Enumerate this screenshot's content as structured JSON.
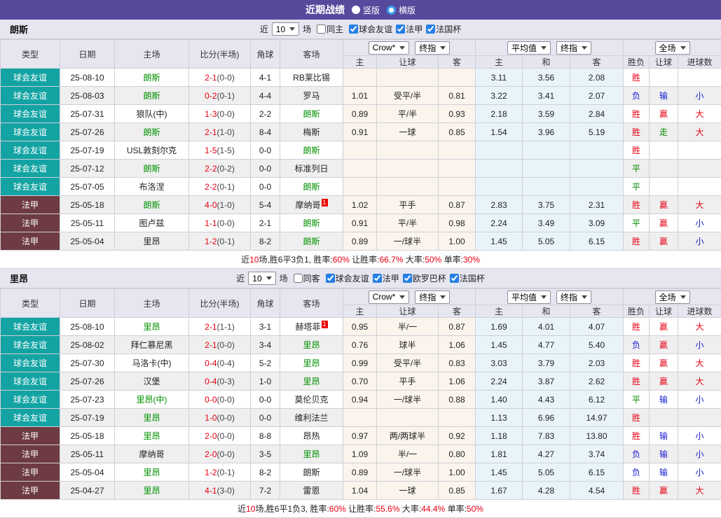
{
  "header": {
    "title": "近期战绩",
    "view_options": [
      {
        "label": "竖版",
        "selected": false
      },
      {
        "label": "横版",
        "selected": true
      }
    ]
  },
  "colors": {
    "header_purple": "#564a9d",
    "friendly_teal": "#13a3a3",
    "ligue1_maroon": "#6d3b41",
    "win_red": "#e60013",
    "loss_blue": "#1818d0",
    "draw_green": "#008800",
    "team_green": "#009100",
    "odds_col_bg": "#faf4ec",
    "avg_col_bg": "#e9f4fa"
  },
  "filter_words": {
    "near": "近",
    "games": "场"
  },
  "selects": {
    "count": "10",
    "odds_provider": "Crow*",
    "odds_stage": "终指",
    "avg_provider": "平均值",
    "avg_stage": "终指",
    "scope": "全场"
  },
  "columns": {
    "type": "类型",
    "date": "日期",
    "home": "主场",
    "score": "比分(半场)",
    "corner": "角球",
    "away": "客场",
    "odds_home": "主",
    "odds_handicap": "让球",
    "odds_away": "客",
    "avg_home": "主",
    "avg_draw": "和",
    "avg_away": "客",
    "result_wl": "胜负",
    "result_handicap": "让球",
    "result_goals": "进球数"
  },
  "sections": [
    {
      "team": "朗斯",
      "filter": {
        "same_label": "同主",
        "same_checked": false,
        "leagues": [
          {
            "label": "球会友谊",
            "checked": true
          },
          {
            "label": "法甲",
            "checked": true
          },
          {
            "label": "法国杯",
            "checked": true
          }
        ]
      },
      "rows": [
        {
          "league": "friendly",
          "type": "球会友谊",
          "date": "25-08-10",
          "home": "朗斯",
          "home_green": true,
          "home_badge": "",
          "score": "2-1",
          "half": "(0-0)",
          "corner": "4-1",
          "away": "RB莱比锡",
          "away_green": false,
          "away_badge": "",
          "odds": [
            "",
            "",
            ""
          ],
          "avg": [
            "3.11",
            "3.56",
            "2.08"
          ],
          "results": [
            [
              "胜",
              "r"
            ],
            [
              "",
              ""
            ],
            [
              "",
              ""
            ]
          ]
        },
        {
          "league": "friendly",
          "type": "球会友谊",
          "date": "25-08-03",
          "home": "朗斯",
          "home_green": true,
          "home_badge": "",
          "score": "0-2",
          "half": "(0-1)",
          "corner": "4-4",
          "away": "罗马",
          "away_green": false,
          "away_badge": "",
          "odds": [
            "1.01",
            "受平/半",
            "0.81"
          ],
          "avg": [
            "3.22",
            "3.41",
            "2.07"
          ],
          "results": [
            [
              "负",
              "b"
            ],
            [
              "输",
              "b"
            ],
            [
              "小",
              "b"
            ]
          ]
        },
        {
          "league": "friendly",
          "type": "球会友谊",
          "date": "25-07-31",
          "home": "狼队(中)",
          "home_green": false,
          "home_badge": "",
          "score": "1-3",
          "half": "(0-0)",
          "corner": "2-2",
          "away": "朗斯",
          "away_green": true,
          "away_badge": "",
          "odds": [
            "0.89",
            "平/半",
            "0.93"
          ],
          "avg": [
            "2.18",
            "3.59",
            "2.84"
          ],
          "results": [
            [
              "胜",
              "r"
            ],
            [
              "赢",
              "r"
            ],
            [
              "大",
              "r"
            ]
          ]
        },
        {
          "league": "friendly",
          "type": "球会友谊",
          "date": "25-07-26",
          "home": "朗斯",
          "home_green": true,
          "home_badge": "",
          "score": "2-1",
          "half": "(1-0)",
          "corner": "8-4",
          "away": "梅斯",
          "away_green": false,
          "away_badge": "",
          "odds": [
            "0.91",
            "一球",
            "0.85"
          ],
          "avg": [
            "1.54",
            "3.96",
            "5.19"
          ],
          "results": [
            [
              "胜",
              "r"
            ],
            [
              "走",
              "g"
            ],
            [
              "大",
              "r"
            ]
          ]
        },
        {
          "league": "friendly",
          "type": "球会友谊",
          "date": "25-07-19",
          "home": "USL敦刻尔克",
          "home_green": false,
          "home_badge": "",
          "score": "1-5",
          "half": "(1-5)",
          "corner": "0-0",
          "away": "朗斯",
          "away_green": true,
          "away_badge": "",
          "odds": [
            "",
            "",
            ""
          ],
          "avg": [
            "",
            "",
            ""
          ],
          "results": [
            [
              "胜",
              "r"
            ],
            [
              "",
              ""
            ],
            [
              "",
              ""
            ]
          ]
        },
        {
          "league": "friendly",
          "type": "球会友谊",
          "date": "25-07-12",
          "home": "朗斯",
          "home_green": true,
          "home_badge": "",
          "score": "2-2",
          "half": "(0-2)",
          "corner": "0-0",
          "away": "标准列日",
          "away_green": false,
          "away_badge": "",
          "odds": [
            "",
            "",
            ""
          ],
          "avg": [
            "",
            "",
            ""
          ],
          "results": [
            [
              "平",
              "g"
            ],
            [
              "",
              ""
            ],
            [
              "",
              ""
            ]
          ]
        },
        {
          "league": "friendly",
          "type": "球会友谊",
          "date": "25-07-05",
          "home": "布洛涅",
          "home_green": false,
          "home_badge": "",
          "score": "2-2",
          "half": "(0-1)",
          "corner": "0-0",
          "away": "朗斯",
          "away_green": true,
          "away_badge": "",
          "odds": [
            "",
            "",
            ""
          ],
          "avg": [
            "",
            "",
            ""
          ],
          "results": [
            [
              "平",
              "g"
            ],
            [
              "",
              ""
            ],
            [
              "",
              ""
            ]
          ]
        },
        {
          "league": "ligue1",
          "type": "法甲",
          "date": "25-05-18",
          "home": "朗斯",
          "home_green": true,
          "home_badge": "",
          "score": "4-0",
          "half": "(1-0)",
          "corner": "5-4",
          "away": "摩纳哥",
          "away_green": false,
          "away_badge": "1",
          "odds": [
            "1.02",
            "平手",
            "0.87"
          ],
          "avg": [
            "2.83",
            "3.75",
            "2.31"
          ],
          "results": [
            [
              "胜",
              "r"
            ],
            [
              "赢",
              "r"
            ],
            [
              "大",
              "r"
            ]
          ]
        },
        {
          "league": "ligue1",
          "type": "法甲",
          "date": "25-05-11",
          "home": "图卢兹",
          "home_green": false,
          "home_badge": "",
          "score": "1-1",
          "half": "(0-0)",
          "corner": "2-1",
          "away": "朗斯",
          "away_green": true,
          "away_badge": "",
          "odds": [
            "0.91",
            "平/半",
            "0.98"
          ],
          "avg": [
            "2.24",
            "3.49",
            "3.09"
          ],
          "results": [
            [
              "平",
              "g"
            ],
            [
              "赢",
              "r"
            ],
            [
              "小",
              "b"
            ]
          ]
        },
        {
          "league": "ligue1",
          "type": "法甲",
          "date": "25-05-04",
          "home": "里昂",
          "home_green": false,
          "home_badge": "",
          "score": "1-2",
          "half": "(0-1)",
          "corner": "8-2",
          "away": "朗斯",
          "away_green": true,
          "away_badge": "",
          "odds": [
            "0.89",
            "一/球半",
            "1.00"
          ],
          "avg": [
            "1.45",
            "5.05",
            "6.15"
          ],
          "results": [
            [
              "胜",
              "r"
            ],
            [
              "赢",
              "r"
            ],
            [
              "小",
              "b"
            ]
          ]
        }
      ],
      "summary": [
        {
          "text": "近",
          "red": false
        },
        {
          "text": "10",
          "red": true
        },
        {
          "text": "场,胜6平3负1, 胜率:",
          "red": false
        },
        {
          "text": "60%",
          "red": true
        },
        {
          "text": " 让胜率:",
          "red": false
        },
        {
          "text": "66.7%",
          "red": true
        },
        {
          "text": " 大率:",
          "red": false
        },
        {
          "text": "50%",
          "red": true
        },
        {
          "text": " 单率:",
          "red": false
        },
        {
          "text": "30%",
          "red": true
        }
      ]
    },
    {
      "team": "里昂",
      "filter": {
        "same_label": "同客",
        "same_checked": false,
        "leagues": [
          {
            "label": "球会友谊",
            "checked": true
          },
          {
            "label": "法甲",
            "checked": true
          },
          {
            "label": "欧罗巴杯",
            "checked": true
          },
          {
            "label": "法国杯",
            "checked": true
          }
        ]
      },
      "rows": [
        {
          "league": "friendly",
          "type": "球会友谊",
          "date": "25-08-10",
          "home": "里昂",
          "home_green": true,
          "home_badge": "",
          "score": "2-1",
          "half": "(1-1)",
          "corner": "3-1",
          "away": "赫塔菲",
          "away_green": false,
          "away_badge": "1",
          "odds": [
            "0.95",
            "半/一",
            "0.87"
          ],
          "avg": [
            "1.69",
            "4.01",
            "4.07"
          ],
          "results": [
            [
              "胜",
              "r"
            ],
            [
              "赢",
              "r"
            ],
            [
              "大",
              "r"
            ]
          ]
        },
        {
          "league": "friendly",
          "type": "球会友谊",
          "date": "25-08-02",
          "home": "拜仁慕尼黑",
          "home_green": false,
          "home_badge": "",
          "score": "2-1",
          "half": "(0-0)",
          "corner": "3-4",
          "away": "里昂",
          "away_green": true,
          "away_badge": "",
          "odds": [
            "0.76",
            "球半",
            "1.06"
          ],
          "avg": [
            "1.45",
            "4.77",
            "5.40"
          ],
          "results": [
            [
              "负",
              "b"
            ],
            [
              "赢",
              "r"
            ],
            [
              "小",
              "b"
            ]
          ]
        },
        {
          "league": "friendly",
          "type": "球会友谊",
          "date": "25-07-30",
          "home": "马洛卡(中)",
          "home_green": false,
          "home_badge": "",
          "score": "0-4",
          "half": "(0-4)",
          "corner": "5-2",
          "away": "里昂",
          "away_green": true,
          "away_badge": "",
          "odds": [
            "0.99",
            "受平/半",
            "0.83"
          ],
          "avg": [
            "3.03",
            "3.79",
            "2.03"
          ],
          "results": [
            [
              "胜",
              "r"
            ],
            [
              "赢",
              "r"
            ],
            [
              "大",
              "r"
            ]
          ]
        },
        {
          "league": "friendly",
          "type": "球会友谊",
          "date": "25-07-26",
          "home": "汉堡",
          "home_green": false,
          "home_badge": "",
          "score": "0-4",
          "half": "(0-3)",
          "corner": "1-0",
          "away": "里昂",
          "away_green": true,
          "away_badge": "",
          "odds": [
            "0.70",
            "平手",
            "1.06"
          ],
          "avg": [
            "2.24",
            "3.87",
            "2.62"
          ],
          "results": [
            [
              "胜",
              "r"
            ],
            [
              "赢",
              "r"
            ],
            [
              "大",
              "r"
            ]
          ]
        },
        {
          "league": "friendly",
          "type": "球会友谊",
          "date": "25-07-23",
          "home": "里昂(中)",
          "home_green": true,
          "home_badge": "",
          "score": "0-0",
          "half": "(0-0)",
          "corner": "0-0",
          "away": "莫伦贝克",
          "away_green": false,
          "away_badge": "",
          "odds": [
            "0.94",
            "一/球半",
            "0.88"
          ],
          "avg": [
            "1.40",
            "4.43",
            "6.12"
          ],
          "results": [
            [
              "平",
              "g"
            ],
            [
              "输",
              "b"
            ],
            [
              "小",
              "b"
            ]
          ]
        },
        {
          "league": "friendly",
          "type": "球会友谊",
          "date": "25-07-19",
          "home": "里昂",
          "home_green": true,
          "home_badge": "",
          "score": "1-0",
          "half": "(0-0)",
          "corner": "0-0",
          "away": "维利法兰",
          "away_green": false,
          "away_badge": "",
          "odds": [
            "",
            "",
            ""
          ],
          "avg": [
            "1.13",
            "6.96",
            "14.97"
          ],
          "results": [
            [
              "胜",
              "r"
            ],
            [
              "",
              ""
            ],
            [
              "",
              ""
            ]
          ]
        },
        {
          "league": "ligue1",
          "type": "法甲",
          "date": "25-05-18",
          "home": "里昂",
          "home_green": true,
          "home_badge": "",
          "score": "2-0",
          "half": "(0-0)",
          "corner": "8-8",
          "away": "昂热",
          "away_green": false,
          "away_badge": "",
          "odds": [
            "0.97",
            "两/两球半",
            "0.92"
          ],
          "avg": [
            "1.18",
            "7.83",
            "13.80"
          ],
          "results": [
            [
              "胜",
              "r"
            ],
            [
              "输",
              "b"
            ],
            [
              "小",
              "b"
            ]
          ]
        },
        {
          "league": "ligue1",
          "type": "法甲",
          "date": "25-05-11",
          "home": "摩纳哥",
          "home_green": false,
          "home_badge": "",
          "score": "2-0",
          "half": "(0-0)",
          "corner": "3-5",
          "away": "里昂",
          "away_green": true,
          "away_badge": "",
          "odds": [
            "1.09",
            "半/一",
            "0.80"
          ],
          "avg": [
            "1.81",
            "4.27",
            "3.74"
          ],
          "results": [
            [
              "负",
              "b"
            ],
            [
              "输",
              "b"
            ],
            [
              "小",
              "b"
            ]
          ]
        },
        {
          "league": "ligue1",
          "type": "法甲",
          "date": "25-05-04",
          "home": "里昂",
          "home_green": true,
          "home_badge": "",
          "score": "1-2",
          "half": "(0-1)",
          "corner": "8-2",
          "away": "朗斯",
          "away_green": false,
          "away_badge": "",
          "odds": [
            "0.89",
            "一/球半",
            "1.00"
          ],
          "avg": [
            "1.45",
            "5.05",
            "6.15"
          ],
          "results": [
            [
              "负",
              "b"
            ],
            [
              "输",
              "b"
            ],
            [
              "小",
              "b"
            ]
          ]
        },
        {
          "league": "ligue1",
          "type": "法甲",
          "date": "25-04-27",
          "home": "里昂",
          "home_green": true,
          "home_badge": "",
          "score": "4-1",
          "half": "(3-0)",
          "corner": "7-2",
          "away": "雷恩",
          "away_green": false,
          "away_badge": "",
          "odds": [
            "1.04",
            "一球",
            "0.85"
          ],
          "avg": [
            "1.67",
            "4.28",
            "4.54"
          ],
          "results": [
            [
              "胜",
              "r"
            ],
            [
              "赢",
              "r"
            ],
            [
              "大",
              "r"
            ]
          ]
        }
      ],
      "summary": [
        {
          "text": "近",
          "red": false
        },
        {
          "text": "10",
          "red": true
        },
        {
          "text": "场,胜6平1负3, 胜率:",
          "red": false
        },
        {
          "text": "60%",
          "red": true
        },
        {
          "text": " 让胜率:",
          "red": false
        },
        {
          "text": "55.6%",
          "red": true
        },
        {
          "text": " 大率:",
          "red": false
        },
        {
          "text": "44.4%",
          "red": true
        },
        {
          "text": " 单率:",
          "red": false
        },
        {
          "text": "50%",
          "red": true
        }
      ]
    }
  ]
}
